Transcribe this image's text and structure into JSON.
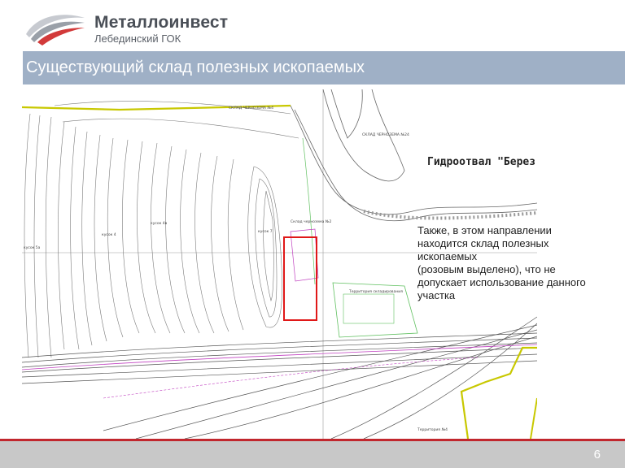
{
  "header": {
    "company_name": "Металлоинвест",
    "company_subtitle": "Лебединский ГОК",
    "logo_icon": "metalloinvest-swoosh-logo"
  },
  "slide": {
    "title": "Существующий склад полезных ископаемых",
    "note": "Также, в этом направлении\nнаходится склад полезных\nископаемых\n(розовым выделено), что не\nдопускает использование данного\nучастка",
    "page_number": "6"
  },
  "map": {
    "hydro_label": "Гидроотвал \"Берез",
    "small_labels": {
      "top1": "СКЛАД ЧЕРНОЗЕМА №4",
      "top2": "СКЛАД ЧЕРНОЗЕМА №24",
      "mid1": "Склад чернозема №2",
      "left1": "кусок 4",
      "left2": "кусок 4в",
      "left3": "кусок 5а",
      "left4": "кусок 7",
      "right1": "Территория складирования",
      "bottom1": "Территория №4"
    },
    "colors": {
      "highlight_box": "#e01818",
      "boundary_yellow": "#c8c800",
      "magenta": "#c040c0",
      "green": "#60c060"
    }
  }
}
